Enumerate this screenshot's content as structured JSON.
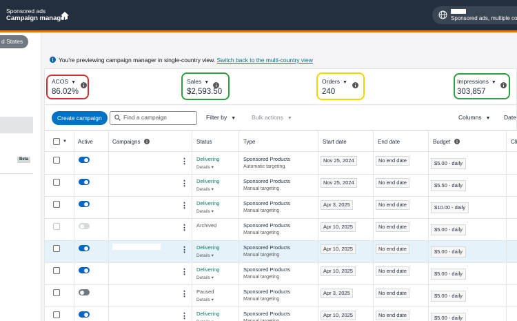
{
  "header": {
    "brand_line1": "Sponsored ads",
    "brand_line2": "Campaign manager",
    "account_text": "Sponsored ads, multiple cou"
  },
  "sidebar": {
    "country_pill": "d States",
    "beta_badge": "Beta"
  },
  "banner": {
    "text": "You're previewing campaign manager in single-country view.",
    "link": "Switch back to the multi-country view"
  },
  "metrics": [
    {
      "label": "ACOS",
      "value": "86.02%",
      "highlight": "#d32f2f"
    },
    {
      "label": "Sales",
      "value": "$2,593.50",
      "highlight": "#2e9e3e"
    },
    {
      "label": "Orders",
      "value": "240",
      "highlight": "#f2d600"
    },
    {
      "label": "Impressions",
      "value": "303,857",
      "highlight": "#2e9e3e"
    }
  ],
  "toolbar": {
    "create_label": "Create campaign",
    "search_placeholder": "Find a campaign",
    "filter_label": "Filter by",
    "bulk_label": "Bulk actions",
    "columns_label": "Columns",
    "date_label": "Date"
  },
  "table": {
    "headers": {
      "active": "Active",
      "campaigns": "Campaigns",
      "status": "Status",
      "type": "Type",
      "start_date": "Start date",
      "end_date": "End date",
      "budget": "Budget",
      "clicks": "Cli"
    },
    "rows": [
      {
        "toggle": "on",
        "status": "Delivering",
        "details": "Details",
        "type": "Sponsored Products",
        "targeting": "Automatic targeting",
        "start": "Nov 25, 2024",
        "end": "No end date",
        "budget": "$5.00 - daily"
      },
      {
        "toggle": "on",
        "status": "Delivering",
        "details": "Details",
        "type": "Sponsored Products",
        "targeting": "Manual targeting",
        "start": "Nov 25, 2024",
        "end": "No end date",
        "budget": "$5.50 - daily"
      },
      {
        "toggle": "on",
        "status": "Delivering",
        "details": "Details",
        "type": "Sponsored Products",
        "targeting": "Manual targeting",
        "start": "Apr 3, 2025",
        "end": "No end date",
        "budget": "$10.00 - daily"
      },
      {
        "toggle": "disabled",
        "status": "Archived",
        "details": "",
        "type": "Sponsored Products",
        "targeting": "Manual targeting",
        "start": "Apr 10, 2025",
        "end": "No end date",
        "budget": "$5.00 - daily"
      },
      {
        "toggle": "on",
        "status": "Delivering",
        "details": "Details",
        "type": "Sponsored Products",
        "targeting": "Manual targeting",
        "start": "Apr 10, 2025",
        "end": "No end date",
        "budget": "$5.00 - daily"
      },
      {
        "toggle": "on",
        "status": "Delivering",
        "details": "Details",
        "type": "Sponsored Products",
        "targeting": "Manual targeting",
        "start": "Apr 10, 2025",
        "end": "No end date",
        "budget": "$5.00 - daily"
      },
      {
        "toggle": "off",
        "status": "Paused",
        "details": "Details",
        "type": "Sponsored Products",
        "targeting": "Manual targeting",
        "start": "Apr 3, 2025",
        "end": "No end date",
        "budget": "$5.00 - daily"
      },
      {
        "toggle": "on",
        "status": "Delivering",
        "details": "Details",
        "type": "Sponsored Products",
        "targeting": "Manual targeting",
        "start": "Apr 10, 2025",
        "end": "No end date",
        "budget": "$5.00 - daily"
      }
    ]
  }
}
